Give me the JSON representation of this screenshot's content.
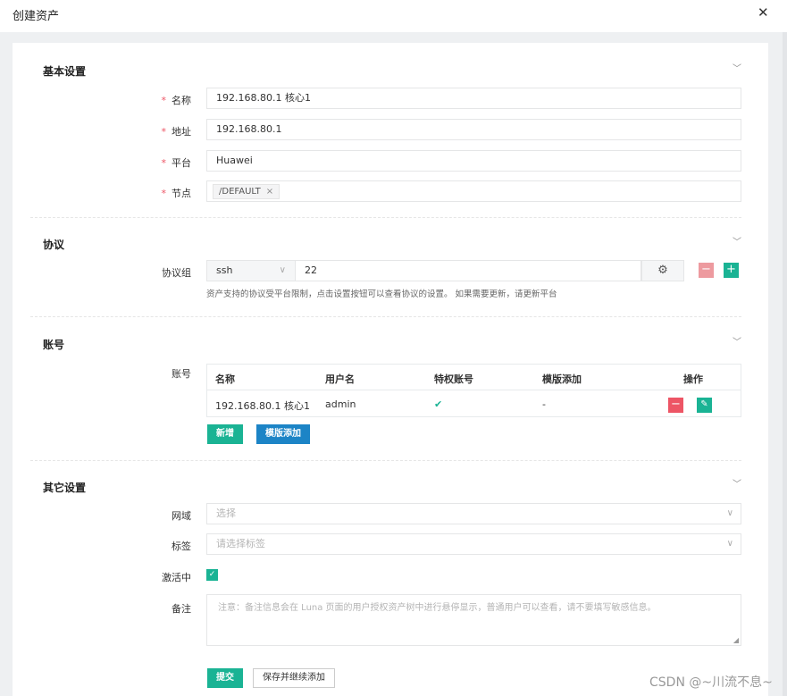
{
  "header": {
    "title": "创建资产",
    "close_icon": "close-icon"
  },
  "sections": {
    "basic": {
      "title": "基本设置",
      "name_label": "名称",
      "name_value": "192.168.80.1 核心1",
      "address_label": "地址",
      "address_value": "192.168.80.1",
      "platform_label": "平台",
      "platform_value": "Huawei",
      "node_label": "节点",
      "node_tag": "/DEFAULT"
    },
    "protocol": {
      "title": "协议",
      "group_label": "协议组",
      "protocol": "ssh",
      "port": "22",
      "hint": "资产支持的协议受平台限制，点击设置按钮可以查看协议的设置。 如果需要更新，请更新平台"
    },
    "account": {
      "title": "账号",
      "field_label": "账号",
      "columns": [
        "名称",
        "用户名",
        "特权账号",
        "模版添加",
        "操作"
      ],
      "rows": [
        {
          "name": "192.168.80.1 核心1",
          "username": "admin",
          "privileged": "✔",
          "template": "-"
        }
      ],
      "add_button": "新增",
      "template_button": "模版添加"
    },
    "other": {
      "title": "其它设置",
      "domain_label": "网域",
      "domain_placeholder": "选择",
      "labels_label": "标签",
      "labels_placeholder": "请选择标签",
      "active_label": "激活中",
      "comment_label": "备注",
      "comment_placeholder": "注意：备注信息会在 Luna 页面的用户授权资产树中进行悬停显示，普通用户可以查看，请不要填写敏感信息。"
    }
  },
  "footer": {
    "submit": "提交",
    "save_continue": "保存并继续添加"
  },
  "watermark": "CSDN @~川流不息~",
  "colors": {
    "green": "#1ab394",
    "blue": "#1c84c6",
    "red": "#ed5565"
  }
}
